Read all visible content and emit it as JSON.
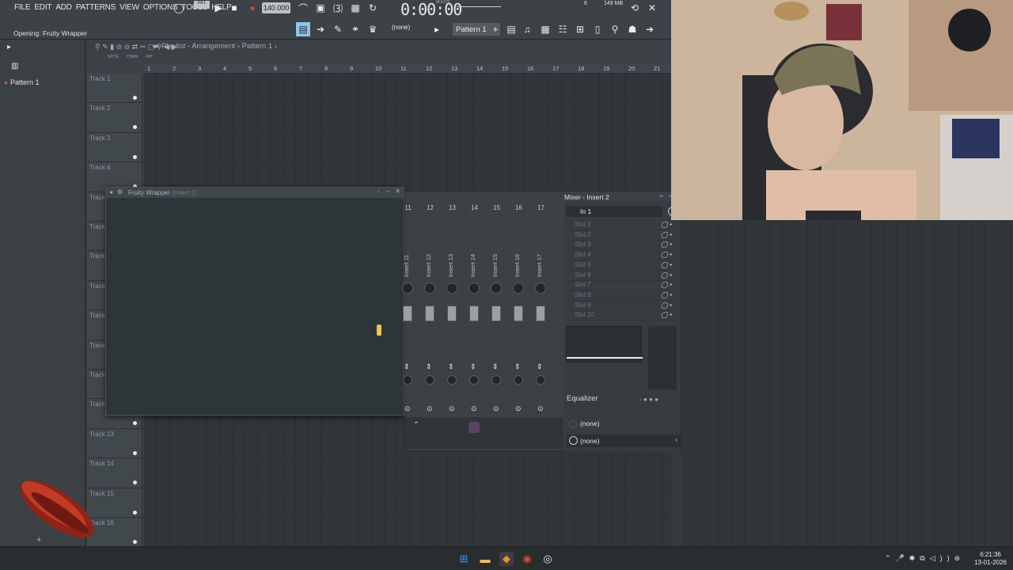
{
  "menu": [
    "FILE",
    "EDIT",
    "ADD",
    "PATTERNS",
    "VIEW",
    "OPTIONS",
    "TOOLS",
    "HELP"
  ],
  "status_hint": "Opening: Fruity Wrapper",
  "transport": {
    "mode": "PAT",
    "tempo": "140.000",
    "time": "0:00:00",
    "time_sub": "M:S:CS",
    "cpu": "6",
    "memory": "149 MB"
  },
  "pattern_selector": "Pattern 1",
  "none_label": "(none)",
  "browser": {
    "items": [
      "Pattern 1"
    ]
  },
  "playlist": {
    "breadcrumb": "Playlist - Arrangement",
    "pattern": "Pattern 1",
    "ruler": [
      "1",
      "2",
      "3",
      "4",
      "5",
      "6",
      "7",
      "8",
      "9",
      "10",
      "11",
      "12",
      "13",
      "14",
      "15",
      "16",
      "17",
      "18",
      "19",
      "20",
      "21"
    ],
    "tracks": [
      "Track 1",
      "Track 2",
      "Track 3",
      "Track 4",
      "Track 5",
      "Track 6",
      "Track 7",
      "Track 8",
      "Track 9",
      "Track 10",
      "Track 11",
      "Track 12",
      "Track 13",
      "Track 14",
      "Track 15",
      "Track 16"
    ],
    "header_buttons": [
      "NOTE",
      "CHAN",
      "PAT"
    ]
  },
  "fruity_wrapper": {
    "title": "Fruity Wrapper",
    "subtitle": "(Insert 2)"
  },
  "mixer": {
    "title": "Mixer - Insert 2",
    "strips": [
      {
        "num": "11",
        "name": "Insert 11"
      },
      {
        "num": "12",
        "name": "Insert 12"
      },
      {
        "num": "13",
        "name": "Insert 13"
      },
      {
        "num": "14",
        "name": "Insert 14"
      },
      {
        "num": "15",
        "name": "Insert 15"
      },
      {
        "num": "16",
        "name": "Insert 16"
      },
      {
        "num": "17",
        "name": "Insert 17"
      }
    ],
    "input": "In 1",
    "slots": [
      "Slot 1",
      "Slot 2",
      "Slot 3",
      "Slot 4",
      "Slot 5",
      "Slot 6",
      "Slot 7",
      "Slot 8",
      "Slot 9",
      "Slot 10"
    ],
    "equalizer": "Equalizer",
    "send_none_1": "(none)",
    "send_none_2": "(none)"
  },
  "taskbar": {
    "time": "6:21:36",
    "date": "13-01-2026"
  },
  "colors": {
    "accent": "#f0a030",
    "record": "#e03b3b",
    "bg": "#343a3e"
  }
}
